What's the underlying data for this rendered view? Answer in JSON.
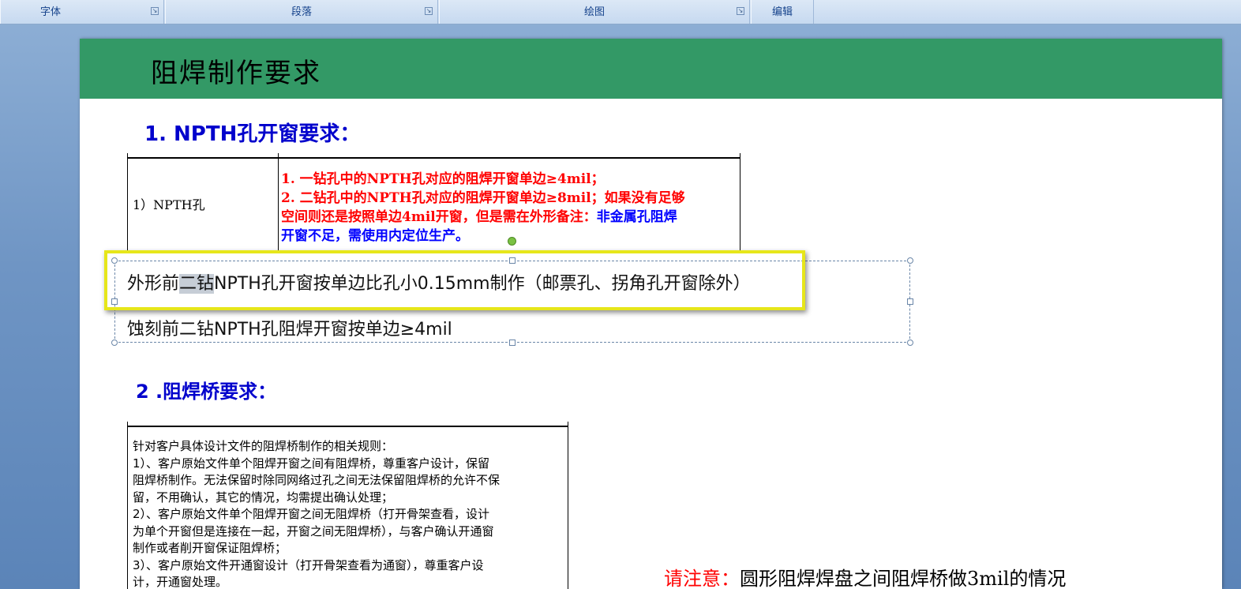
{
  "ribbon": {
    "groups": [
      "字体",
      "段落",
      "绘图",
      "编辑"
    ],
    "launcher_glyph": "↘"
  },
  "slide": {
    "title": "阻焊制作要求",
    "title_bar_color": "#339966",
    "section1_heading": "1. NPTH孔开窗要求：",
    "table1": {
      "left_cell": "1）NPTH孔",
      "line1": "1. 一钻孔中的NPTH孔对应的阻焊开窗单边≥4mil；",
      "line2": "2. 二钻孔中的NPTH孔对应的阻焊开窗单边≥8mil；如果没有足够",
      "line3_red": "空间则还是按照单边4mil开窗，但是需在外形备注：",
      "line3_blue": "非金属孔阻焊",
      "line4": "开窗不足，需使用内定位生产。"
    },
    "textbox": {
      "line1_pre": "外形前",
      "line1_selected": "二钻",
      "line1_post": "NPTH孔开窗按单边比孔小0.15mm制作（邮票孔、拐角孔开窗除外）",
      "line2": "蚀刻前二钻NPTH孔阻焊开窗按单边≥4mil"
    },
    "section2_heading": "2 .阻焊桥要求：",
    "table2": {
      "lines": [
        "针对客户具体设计文件的阻焊桥制作的相关规则：",
        "1）、客户原始文件单个阻焊开窗之间有阻焊桥，尊重客户设计，保留",
        "阻焊桥制作。无法保留时除同网络过孔之间无法保留阻焊桥的允许不保",
        "留，不用确认，其它的情况，均需提出确认处理；",
        "2）、客户原始文件单个阻焊开窗之间无阻焊桥（打开骨架查看，设计",
        "为单个开窗但是连接在一起，开窗之间无阻焊桥），与客户确认开通窗",
        "制作或者削开窗保证阻焊桥；",
        "3）、客户原始文件开通窗设计（打开骨架查看为通窗），尊重客户设",
        "计，开通窗处理。"
      ]
    },
    "note": {
      "label": "请注意：",
      "text": "圆形阻焊焊盘之间阻焊桥做3mil的情况"
    }
  }
}
